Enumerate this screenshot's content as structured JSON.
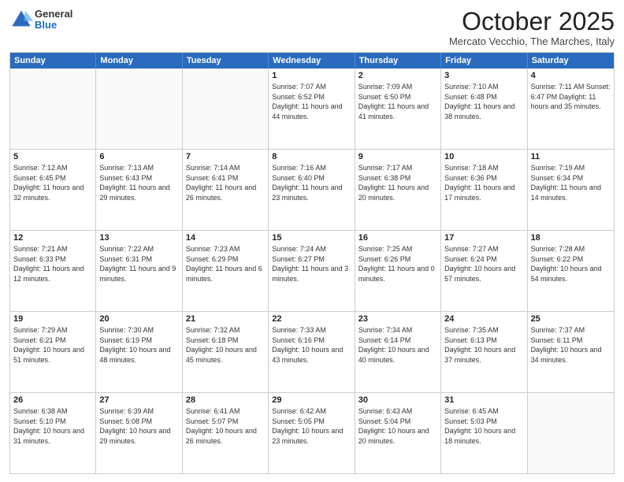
{
  "logo": {
    "general": "General",
    "blue": "Blue"
  },
  "header": {
    "month": "October 2025",
    "location": "Mercato Vecchio, The Marches, Italy"
  },
  "weekdays": [
    "Sunday",
    "Monday",
    "Tuesday",
    "Wednesday",
    "Thursday",
    "Friday",
    "Saturday"
  ],
  "rows": [
    [
      {
        "day": "",
        "text": ""
      },
      {
        "day": "",
        "text": ""
      },
      {
        "day": "",
        "text": ""
      },
      {
        "day": "1",
        "text": "Sunrise: 7:07 AM\nSunset: 6:52 PM\nDaylight: 11 hours and 44 minutes."
      },
      {
        "day": "2",
        "text": "Sunrise: 7:09 AM\nSunset: 6:50 PM\nDaylight: 11 hours and 41 minutes."
      },
      {
        "day": "3",
        "text": "Sunrise: 7:10 AM\nSunset: 6:48 PM\nDaylight: 11 hours and 38 minutes."
      },
      {
        "day": "4",
        "text": "Sunrise: 7:11 AM\nSunset: 6:47 PM\nDaylight: 11 hours and 35 minutes."
      }
    ],
    [
      {
        "day": "5",
        "text": "Sunrise: 7:12 AM\nSunset: 6:45 PM\nDaylight: 11 hours and 32 minutes."
      },
      {
        "day": "6",
        "text": "Sunrise: 7:13 AM\nSunset: 6:43 PM\nDaylight: 11 hours and 29 minutes."
      },
      {
        "day": "7",
        "text": "Sunrise: 7:14 AM\nSunset: 6:41 PM\nDaylight: 11 hours and 26 minutes."
      },
      {
        "day": "8",
        "text": "Sunrise: 7:16 AM\nSunset: 6:40 PM\nDaylight: 11 hours and 23 minutes."
      },
      {
        "day": "9",
        "text": "Sunrise: 7:17 AM\nSunset: 6:38 PM\nDaylight: 11 hours and 20 minutes."
      },
      {
        "day": "10",
        "text": "Sunrise: 7:18 AM\nSunset: 6:36 PM\nDaylight: 11 hours and 17 minutes."
      },
      {
        "day": "11",
        "text": "Sunrise: 7:19 AM\nSunset: 6:34 PM\nDaylight: 11 hours and 14 minutes."
      }
    ],
    [
      {
        "day": "12",
        "text": "Sunrise: 7:21 AM\nSunset: 6:33 PM\nDaylight: 11 hours and 12 minutes."
      },
      {
        "day": "13",
        "text": "Sunrise: 7:22 AM\nSunset: 6:31 PM\nDaylight: 11 hours and 9 minutes."
      },
      {
        "day": "14",
        "text": "Sunrise: 7:23 AM\nSunset: 6:29 PM\nDaylight: 11 hours and 6 minutes."
      },
      {
        "day": "15",
        "text": "Sunrise: 7:24 AM\nSunset: 6:27 PM\nDaylight: 11 hours and 3 minutes."
      },
      {
        "day": "16",
        "text": "Sunrise: 7:25 AM\nSunset: 6:26 PM\nDaylight: 11 hours and 0 minutes."
      },
      {
        "day": "17",
        "text": "Sunrise: 7:27 AM\nSunset: 6:24 PM\nDaylight: 10 hours and 57 minutes."
      },
      {
        "day": "18",
        "text": "Sunrise: 7:28 AM\nSunset: 6:22 PM\nDaylight: 10 hours and 54 minutes."
      }
    ],
    [
      {
        "day": "19",
        "text": "Sunrise: 7:29 AM\nSunset: 6:21 PM\nDaylight: 10 hours and 51 minutes."
      },
      {
        "day": "20",
        "text": "Sunrise: 7:30 AM\nSunset: 6:19 PM\nDaylight: 10 hours and 48 minutes."
      },
      {
        "day": "21",
        "text": "Sunrise: 7:32 AM\nSunset: 6:18 PM\nDaylight: 10 hours and 45 minutes."
      },
      {
        "day": "22",
        "text": "Sunrise: 7:33 AM\nSunset: 6:16 PM\nDaylight: 10 hours and 43 minutes."
      },
      {
        "day": "23",
        "text": "Sunrise: 7:34 AM\nSunset: 6:14 PM\nDaylight: 10 hours and 40 minutes."
      },
      {
        "day": "24",
        "text": "Sunrise: 7:35 AM\nSunset: 6:13 PM\nDaylight: 10 hours and 37 minutes."
      },
      {
        "day": "25",
        "text": "Sunrise: 7:37 AM\nSunset: 6:11 PM\nDaylight: 10 hours and 34 minutes."
      }
    ],
    [
      {
        "day": "26",
        "text": "Sunrise: 6:38 AM\nSunset: 5:10 PM\nDaylight: 10 hours and 31 minutes."
      },
      {
        "day": "27",
        "text": "Sunrise: 6:39 AM\nSunset: 5:08 PM\nDaylight: 10 hours and 29 minutes."
      },
      {
        "day": "28",
        "text": "Sunrise: 6:41 AM\nSunset: 5:07 PM\nDaylight: 10 hours and 26 minutes."
      },
      {
        "day": "29",
        "text": "Sunrise: 6:42 AM\nSunset: 5:05 PM\nDaylight: 10 hours and 23 minutes."
      },
      {
        "day": "30",
        "text": "Sunrise: 6:43 AM\nSunset: 5:04 PM\nDaylight: 10 hours and 20 minutes."
      },
      {
        "day": "31",
        "text": "Sunrise: 6:45 AM\nSunset: 5:03 PM\nDaylight: 10 hours and 18 minutes."
      },
      {
        "day": "",
        "text": ""
      }
    ]
  ]
}
